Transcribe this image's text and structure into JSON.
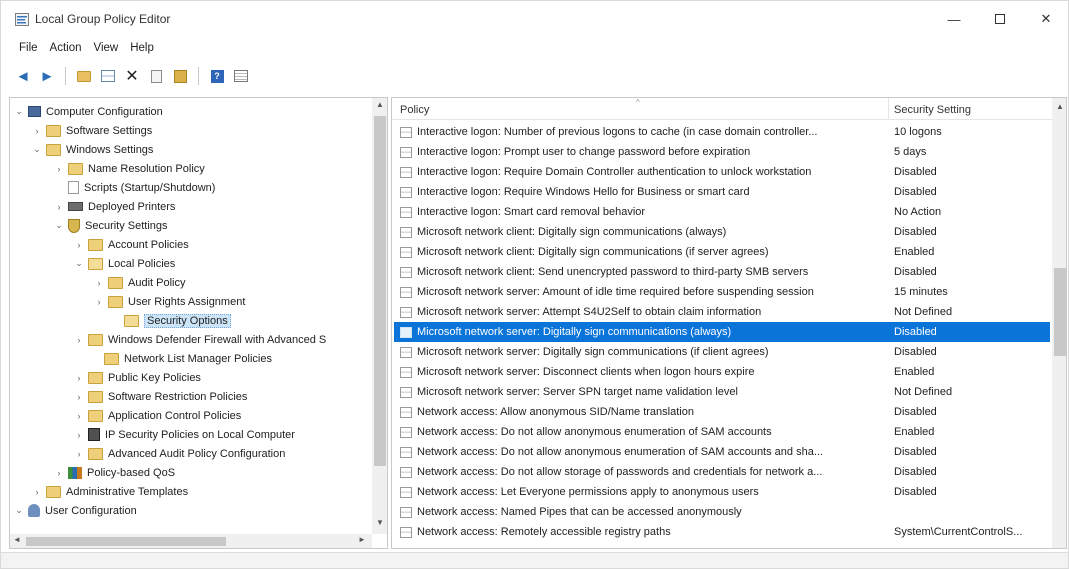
{
  "window": {
    "title": "Local Group Policy Editor",
    "minimize_glyph": "—",
    "close_glyph": "✕"
  },
  "menu": [
    "File",
    "Action",
    "View",
    "Help"
  ],
  "toolbar": {
    "back_glyph": "◄",
    "forward_glyph": "►",
    "delete_glyph": "✕",
    "help_glyph": "?"
  },
  "tree": [
    {
      "label": "Computer Configuration",
      "expander": "⌄",
      "icon": "computer-icon"
    },
    {
      "label": "Software Settings",
      "expander": "›",
      "icon": "folder-icon"
    },
    {
      "label": "Windows Settings",
      "expander": "⌄",
      "icon": "folder-icon"
    },
    {
      "label": "Name Resolution Policy",
      "expander": "›",
      "icon": "folder-icon"
    },
    {
      "label": "Scripts (Startup/Shutdown)",
      "expander": "",
      "icon": "script-icon"
    },
    {
      "label": "Deployed Printers",
      "expander": "›",
      "icon": "printer-icon"
    },
    {
      "label": "Security Settings",
      "expander": "⌄",
      "icon": "security-icon"
    },
    {
      "label": "Account Policies",
      "expander": "›",
      "icon": "folder-icon"
    },
    {
      "label": "Local Policies",
      "expander": "⌄",
      "icon": "folder-open-icon"
    },
    {
      "label": "Audit Policy",
      "expander": "›",
      "icon": "folder-icon"
    },
    {
      "label": "User Rights Assignment",
      "expander": "›",
      "icon": "folder-icon"
    },
    {
      "label": "Security Options",
      "expander": "",
      "icon": "folder-open-icon"
    },
    {
      "label": "Windows Defender Firewall with Advanced S",
      "expander": "›",
      "icon": "folder-icon"
    },
    {
      "label": "Network List Manager Policies",
      "expander": "",
      "icon": "folder-icon"
    },
    {
      "label": "Public Key Policies",
      "expander": "›",
      "icon": "folder-icon"
    },
    {
      "label": "Software Restriction Policies",
      "expander": "›",
      "icon": "folder-icon"
    },
    {
      "label": "Application Control Policies",
      "expander": "›",
      "icon": "folder-icon"
    },
    {
      "label": "IP Security Policies on Local Computer",
      "expander": "›",
      "icon": "ipsec-icon"
    },
    {
      "label": "Advanced Audit Policy Configuration",
      "expander": "›",
      "icon": "folder-icon"
    },
    {
      "label": "Policy-based QoS",
      "expander": "›",
      "icon": "qos-icon"
    },
    {
      "label": "Administrative Templates",
      "expander": "›",
      "icon": "folder-icon"
    },
    {
      "label": "User Configuration",
      "expander": "⌄",
      "icon": "user-icon"
    }
  ],
  "tree_selected_index": 11,
  "list": {
    "columns": [
      "Policy",
      "Security Setting"
    ],
    "rows": [
      {
        "policy": "Interactive logon: Number of previous logons to cache (in case domain controller...",
        "setting": "10 logons"
      },
      {
        "policy": "Interactive logon: Prompt user to change password before expiration",
        "setting": "5 days"
      },
      {
        "policy": "Interactive logon: Require Domain Controller authentication to unlock workstation",
        "setting": "Disabled"
      },
      {
        "policy": "Interactive logon: Require Windows Hello for Business or smart card",
        "setting": "Disabled"
      },
      {
        "policy": "Interactive logon: Smart card removal behavior",
        "setting": "No Action"
      },
      {
        "policy": "Microsoft network client: Digitally sign communications (always)",
        "setting": "Disabled"
      },
      {
        "policy": "Microsoft network client: Digitally sign communications (if server agrees)",
        "setting": "Enabled"
      },
      {
        "policy": "Microsoft network client: Send unencrypted password to third-party SMB servers",
        "setting": "Disabled"
      },
      {
        "policy": "Microsoft network server: Amount of idle time required before suspending session",
        "setting": "15 minutes"
      },
      {
        "policy": "Microsoft network server: Attempt S4U2Self to obtain claim information",
        "setting": "Not Defined"
      },
      {
        "policy": "Microsoft network server: Digitally sign communications (always)",
        "setting": "Disabled"
      },
      {
        "policy": "Microsoft network server: Digitally sign communications (if client agrees)",
        "setting": "Disabled"
      },
      {
        "policy": "Microsoft network server: Disconnect clients when logon hours expire",
        "setting": "Enabled"
      },
      {
        "policy": "Microsoft network server: Server SPN target name validation level",
        "setting": "Not Defined"
      },
      {
        "policy": "Network access: Allow anonymous SID/Name translation",
        "setting": "Disabled"
      },
      {
        "policy": "Network access: Do not allow anonymous enumeration of SAM accounts",
        "setting": "Enabled"
      },
      {
        "policy": "Network access: Do not allow anonymous enumeration of SAM accounts and sha...",
        "setting": "Disabled"
      },
      {
        "policy": "Network access: Do not allow storage of passwords and credentials for network a...",
        "setting": "Disabled"
      },
      {
        "policy": "Network access: Let Everyone permissions apply to anonymous users",
        "setting": "Disabled"
      },
      {
        "policy": "Network access: Named Pipes that can be accessed anonymously",
        "setting": ""
      },
      {
        "policy": "Network access: Remotely accessible registry paths",
        "setting": "System\\CurrentControlS..."
      }
    ],
    "selected_index": 10
  },
  "colors": {
    "selection": "#0a74d9",
    "tree_selection": "#cce4f7"
  }
}
